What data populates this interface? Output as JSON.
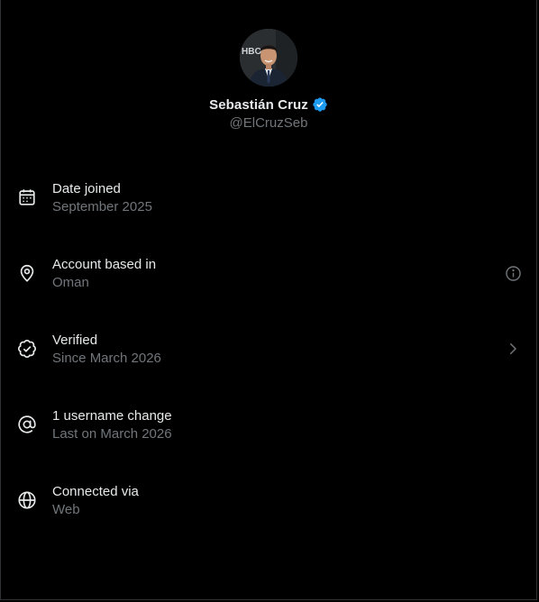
{
  "profile": {
    "name": "Sebastián Cruz",
    "handle": "@ElCruzSeb",
    "verified_badge_color": "#1d9bf0"
  },
  "rows": [
    {
      "icon": "calendar-icon",
      "label": "Date joined",
      "value": "September 2025"
    },
    {
      "icon": "location-pin-icon",
      "label": "Account based in",
      "value": "Oman",
      "trailing_icon": "info-icon"
    },
    {
      "icon": "verified-check-icon",
      "label": "Verified",
      "value": "Since March 2026",
      "trailing_icon": "chevron-right-icon"
    },
    {
      "icon": "at-sign-icon",
      "label": "1 username change",
      "value": "Last on March 2026"
    },
    {
      "icon": "globe-icon",
      "label": "Connected via",
      "value": "Web"
    }
  ],
  "colors": {
    "background": "#000000",
    "primary_text": "#e7e9ea",
    "secondary_text": "#71767b",
    "accent": "#1d9bf0"
  }
}
